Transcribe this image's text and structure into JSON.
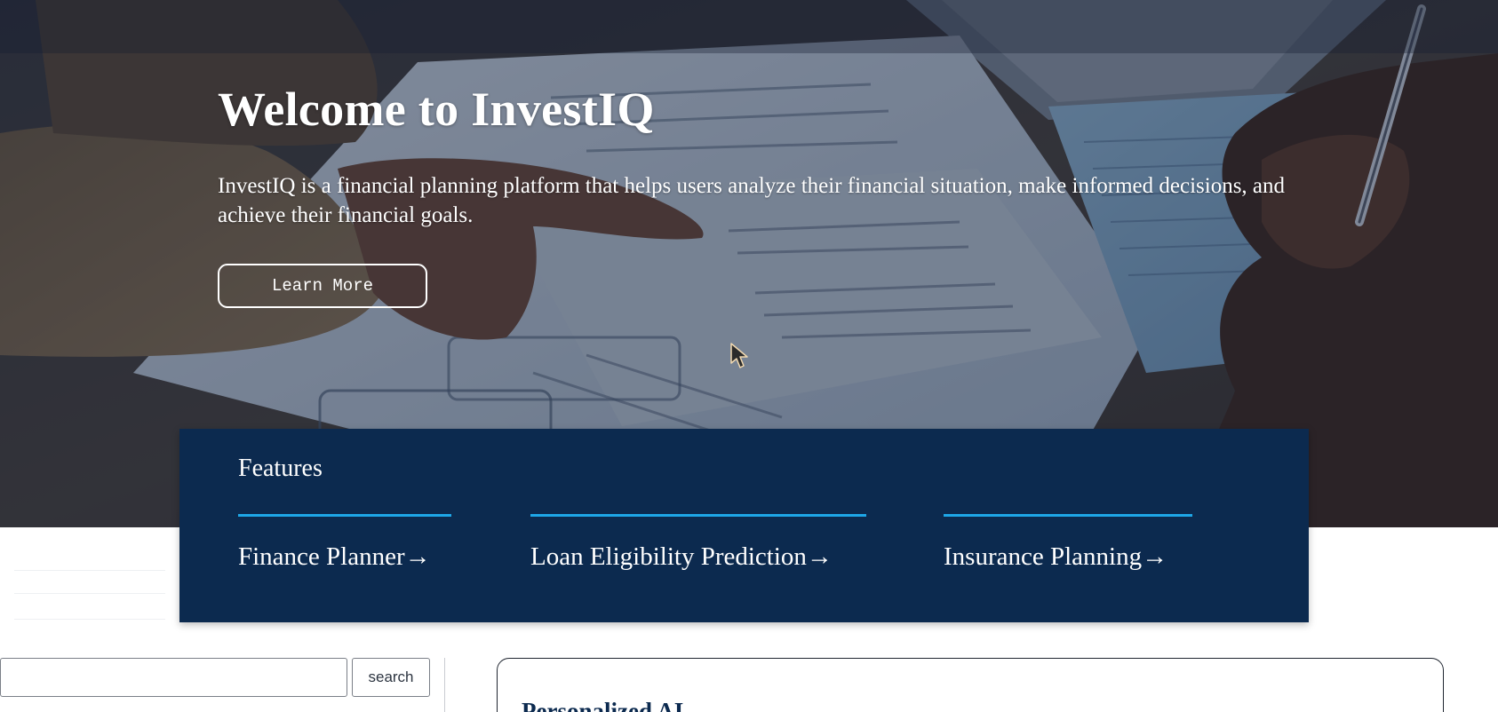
{
  "hero": {
    "title": "Welcome to InvestIQ",
    "description": "InvestIQ is a financial planning platform that helps users analyze their financial situation, make informed decisions, and achieve their financial goals.",
    "cta_label": "Learn More"
  },
  "features": {
    "title": "Features",
    "items": [
      {
        "label": "Finance Planner→"
      },
      {
        "label": "Loan Eligibility Prediction→"
      },
      {
        "label": "Insurance Planning→"
      }
    ],
    "accent_color": "#1ea7e8",
    "background_color": "#0c2a4f"
  },
  "search": {
    "value": "",
    "button_label": "search"
  },
  "ai_card": {
    "title": "Personalized AI"
  },
  "icons": {
    "cursor": "mouse-pointer-icon"
  }
}
